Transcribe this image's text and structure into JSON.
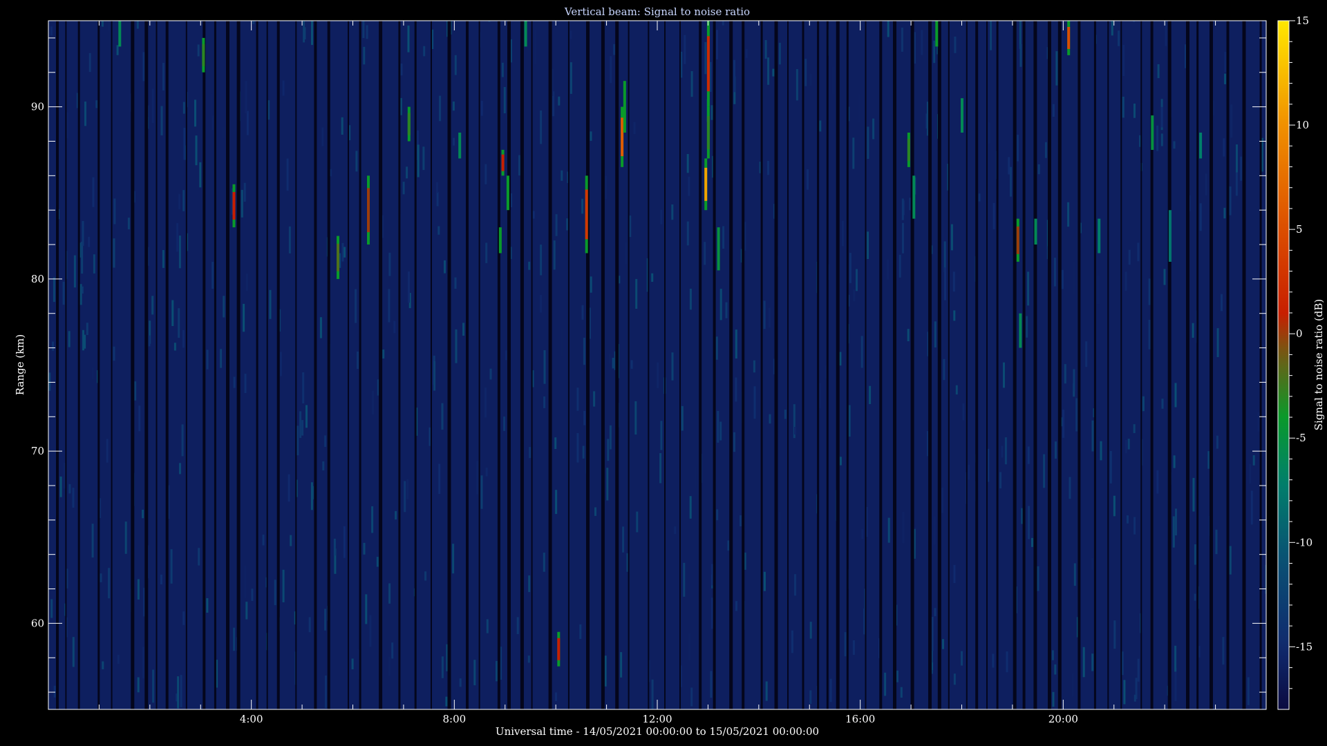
{
  "chart_data": {
    "type": "heatmap",
    "title": "Vertical beam: Signal to noise ratio",
    "xlabel": "Universal time - 14/05/2021 00:00:00 to 15/05/2021 00:00:00",
    "ylabel": "Range (km)",
    "colorbar_label": "Signal to noise ratio (dB)",
    "x_range_hours": [
      0,
      24
    ],
    "x_ticks": [
      {
        "hour": 4,
        "label": "4:00"
      },
      {
        "hour": 8,
        "label": "8:00"
      },
      {
        "hour": 12,
        "label": "12:00"
      },
      {
        "hour": 16,
        "label": "16:00"
      },
      {
        "hour": 20,
        "label": "20:00"
      }
    ],
    "y_range_km": [
      55,
      95
    ],
    "y_ticks": [
      60,
      70,
      80,
      90
    ],
    "color_range_db": [
      -18,
      15
    ],
    "color_ticks": [
      15,
      10,
      5,
      0,
      -5,
      -10,
      -15
    ],
    "background_db": -16,
    "colormap": [
      {
        "db": -18,
        "color": "#0a0a40"
      },
      {
        "db": -15,
        "color": "#102a6e"
      },
      {
        "db": -11,
        "color": "#0a4f74"
      },
      {
        "db": -7,
        "color": "#00806a"
      },
      {
        "db": -4,
        "color": "#0a9a2a"
      },
      {
        "db": -1,
        "color": "#705c14"
      },
      {
        "db": 1,
        "color": "#c81e00"
      },
      {
        "db": 5,
        "color": "#dc4e00"
      },
      {
        "db": 10,
        "color": "#f09000"
      },
      {
        "db": 15,
        "color": "#ffe800"
      }
    ],
    "echoes": [
      {
        "hour": 1.4,
        "r0": 93.5,
        "r1": 95,
        "db": -6
      },
      {
        "hour": 3.05,
        "r0": 92,
        "r1": 94,
        "db": -3
      },
      {
        "hour": 3.65,
        "r0": 83,
        "r1": 85.5,
        "db": 1
      },
      {
        "hour": 5.7,
        "r0": 80,
        "r1": 82.5,
        "db": -2
      },
      {
        "hour": 6.3,
        "r0": 82,
        "r1": 86,
        "db": 0
      },
      {
        "hour": 7.1,
        "r0": 88,
        "r1": 90,
        "db": -3
      },
      {
        "hour": 8.1,
        "r0": 87,
        "r1": 88.5,
        "db": -6
      },
      {
        "hour": 8.9,
        "r0": 81.5,
        "r1": 83,
        "db": -4
      },
      {
        "hour": 8.95,
        "r0": 86,
        "r1": 87.5,
        "db": 1
      },
      {
        "hour": 9.05,
        "r0": 84,
        "r1": 86,
        "db": -4
      },
      {
        "hour": 9.4,
        "r0": 93.5,
        "r1": 95,
        "db": -6
      },
      {
        "hour": 10.05,
        "r0": 57.5,
        "r1": 59.5,
        "db": 1
      },
      {
        "hour": 10.6,
        "r0": 81.5,
        "r1": 86,
        "db": 3
      },
      {
        "hour": 11.3,
        "r0": 86.5,
        "r1": 90,
        "db": 6
      },
      {
        "hour": 11.35,
        "r0": 88.5,
        "r1": 91.5,
        "db": -4
      },
      {
        "hour": 12.95,
        "r0": 84,
        "r1": 87,
        "db": 11
      },
      {
        "hour": 13.0,
        "r0": 90,
        "r1": 95,
        "db": 2
      },
      {
        "hour": 13.0,
        "r0": 87,
        "r1": 90,
        "db": -3
      },
      {
        "hour": 13.2,
        "r0": 80.5,
        "r1": 83,
        "db": -5
      },
      {
        "hour": 16.95,
        "r0": 86.5,
        "r1": 88.5,
        "db": -3
      },
      {
        "hour": 17.05,
        "r0": 83.5,
        "r1": 86,
        "db": -6
      },
      {
        "hour": 17.5,
        "r0": 93.5,
        "r1": 95,
        "db": -4
      },
      {
        "hour": 18.0,
        "r0": 88.5,
        "r1": 90.5,
        "db": -6
      },
      {
        "hour": 19.1,
        "r0": 81,
        "r1": 83.5,
        "db": 0
      },
      {
        "hour": 19.15,
        "r0": 76,
        "r1": 78,
        "db": -6
      },
      {
        "hour": 19.45,
        "r0": 82,
        "r1": 83.5,
        "db": -6
      },
      {
        "hour": 20.1,
        "r0": 93,
        "r1": 95,
        "db": 5
      },
      {
        "hour": 20.7,
        "r0": 81.5,
        "r1": 83.5,
        "db": -7
      },
      {
        "hour": 21.75,
        "r0": 87.5,
        "r1": 89.5,
        "db": -5
      },
      {
        "hour": 22.1,
        "r0": 81,
        "r1": 84,
        "db": -8
      },
      {
        "hour": 22.7,
        "r0": 87,
        "r1": 88.5,
        "db": -7
      }
    ]
  }
}
